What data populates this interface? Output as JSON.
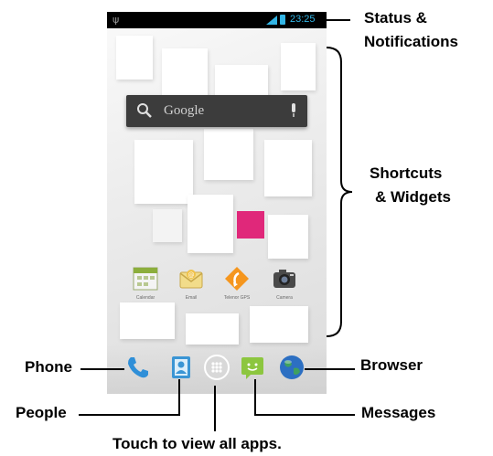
{
  "status_bar": {
    "time": "23:25"
  },
  "search_widget": {
    "placeholder": "Google"
  },
  "home_apps": [
    {
      "label": "Calendar",
      "icon": "calendar-icon"
    },
    {
      "label": "Email",
      "icon": "email-icon"
    },
    {
      "label": "Telenor GPS",
      "icon": "gps-icon"
    },
    {
      "label": "Camera",
      "icon": "camera-icon"
    }
  ],
  "dock": [
    {
      "icon": "phone-icon"
    },
    {
      "icon": "people-icon"
    },
    {
      "icon": "all-apps-icon"
    },
    {
      "icon": "messages-icon"
    },
    {
      "icon": "browser-icon"
    }
  ],
  "callouts": {
    "status": "Status & Notifications",
    "status_line1": "Status &",
    "status_line2": "Notifications",
    "shortcuts_line1": "Shortcuts",
    "shortcuts_line2": "& Widgets",
    "phone": "Phone",
    "people": "People",
    "all_apps": "Touch to view all apps.",
    "browser": "Browser",
    "messages": "Messages"
  },
  "colors": {
    "accent": "#33b5e5",
    "pink_tile": "#e0287a",
    "status_bar": "#000000"
  }
}
